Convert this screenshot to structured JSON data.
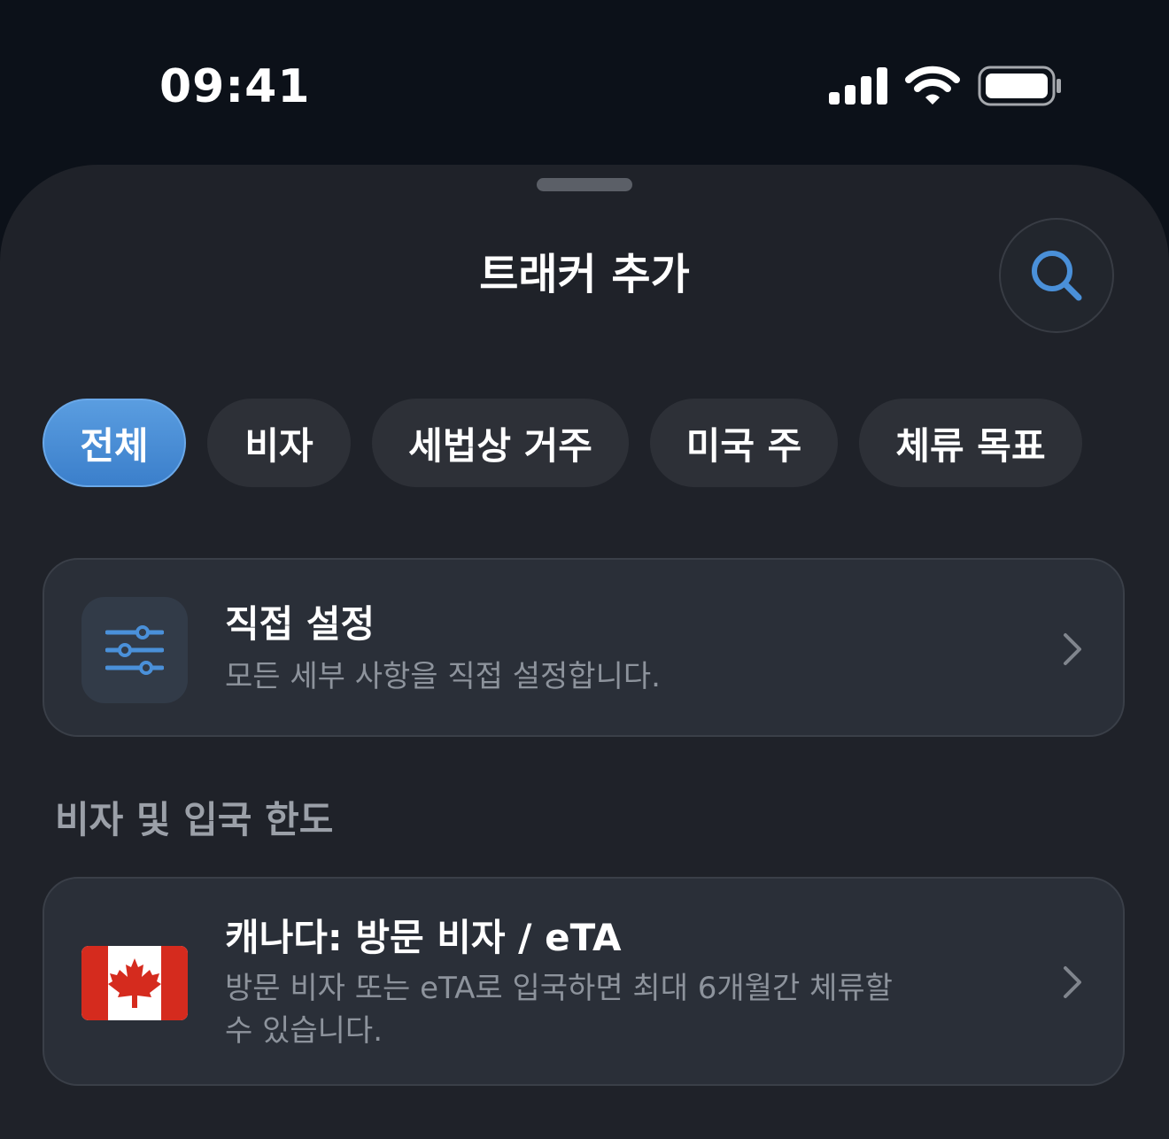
{
  "status_bar": {
    "time": "09:41",
    "icons": [
      "signal-bars-icon",
      "wifi-icon",
      "battery-icon"
    ]
  },
  "sheet": {
    "title": "트래커 추가",
    "search_icon": "magnifier-icon"
  },
  "filters": [
    {
      "label": "전체",
      "selected": true
    },
    {
      "label": "비자",
      "selected": false
    },
    {
      "label": "세법상 거주",
      "selected": false
    },
    {
      "label": "미국 주",
      "selected": false
    },
    {
      "label": "체류 목표",
      "selected": false
    }
  ],
  "custom_card": {
    "icon": "sliders-icon",
    "title": "직접 설정",
    "description": "모든 세부 사항을 직접 설정합니다."
  },
  "section": {
    "title": "비자 및 입국 한도"
  },
  "tracker_cards": [
    {
      "icon": "canada-flag-icon",
      "title": "캐나다: 방문 비자 / eTA",
      "description_line1": "방문 비자 또는 eTA로 입국하면 최대 6개월간 체류할",
      "description_line2": "수 있습니다."
    }
  ],
  "colors": {
    "background": "#0c1119",
    "sheet": "#1f2229",
    "card": "#2a2f38",
    "chip": "#2d3037",
    "accent": "#4a90d9",
    "secondary_text": "#8d939c"
  }
}
